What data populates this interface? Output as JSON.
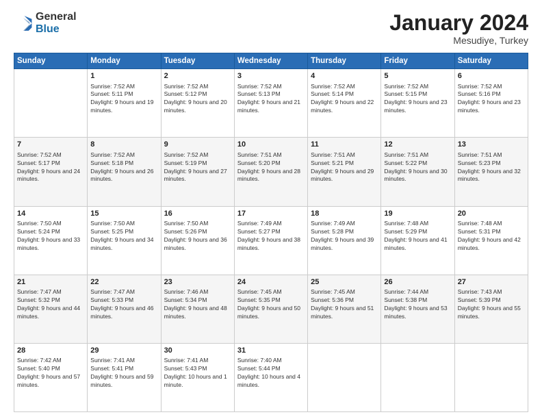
{
  "logo": {
    "general": "General",
    "blue": "Blue"
  },
  "title": "January 2024",
  "subtitle": "Mesudiye, Turkey",
  "header_days": [
    "Sunday",
    "Monday",
    "Tuesday",
    "Wednesday",
    "Thursday",
    "Friday",
    "Saturday"
  ],
  "weeks": [
    [
      {
        "day": "",
        "sunrise": "",
        "sunset": "",
        "daylight": ""
      },
      {
        "day": "1",
        "sunrise": "Sunrise: 7:52 AM",
        "sunset": "Sunset: 5:11 PM",
        "daylight": "Daylight: 9 hours and 19 minutes."
      },
      {
        "day": "2",
        "sunrise": "Sunrise: 7:52 AM",
        "sunset": "Sunset: 5:12 PM",
        "daylight": "Daylight: 9 hours and 20 minutes."
      },
      {
        "day": "3",
        "sunrise": "Sunrise: 7:52 AM",
        "sunset": "Sunset: 5:13 PM",
        "daylight": "Daylight: 9 hours and 21 minutes."
      },
      {
        "day": "4",
        "sunrise": "Sunrise: 7:52 AM",
        "sunset": "Sunset: 5:14 PM",
        "daylight": "Daylight: 9 hours and 22 minutes."
      },
      {
        "day": "5",
        "sunrise": "Sunrise: 7:52 AM",
        "sunset": "Sunset: 5:15 PM",
        "daylight": "Daylight: 9 hours and 23 minutes."
      },
      {
        "day": "6",
        "sunrise": "Sunrise: 7:52 AM",
        "sunset": "Sunset: 5:16 PM",
        "daylight": "Daylight: 9 hours and 23 minutes."
      }
    ],
    [
      {
        "day": "7",
        "sunrise": "Sunrise: 7:52 AM",
        "sunset": "Sunset: 5:17 PM",
        "daylight": "Daylight: 9 hours and 24 minutes."
      },
      {
        "day": "8",
        "sunrise": "Sunrise: 7:52 AM",
        "sunset": "Sunset: 5:18 PM",
        "daylight": "Daylight: 9 hours and 26 minutes."
      },
      {
        "day": "9",
        "sunrise": "Sunrise: 7:52 AM",
        "sunset": "Sunset: 5:19 PM",
        "daylight": "Daylight: 9 hours and 27 minutes."
      },
      {
        "day": "10",
        "sunrise": "Sunrise: 7:51 AM",
        "sunset": "Sunset: 5:20 PM",
        "daylight": "Daylight: 9 hours and 28 minutes."
      },
      {
        "day": "11",
        "sunrise": "Sunrise: 7:51 AM",
        "sunset": "Sunset: 5:21 PM",
        "daylight": "Daylight: 9 hours and 29 minutes."
      },
      {
        "day": "12",
        "sunrise": "Sunrise: 7:51 AM",
        "sunset": "Sunset: 5:22 PM",
        "daylight": "Daylight: 9 hours and 30 minutes."
      },
      {
        "day": "13",
        "sunrise": "Sunrise: 7:51 AM",
        "sunset": "Sunset: 5:23 PM",
        "daylight": "Daylight: 9 hours and 32 minutes."
      }
    ],
    [
      {
        "day": "14",
        "sunrise": "Sunrise: 7:50 AM",
        "sunset": "Sunset: 5:24 PM",
        "daylight": "Daylight: 9 hours and 33 minutes."
      },
      {
        "day": "15",
        "sunrise": "Sunrise: 7:50 AM",
        "sunset": "Sunset: 5:25 PM",
        "daylight": "Daylight: 9 hours and 34 minutes."
      },
      {
        "day": "16",
        "sunrise": "Sunrise: 7:50 AM",
        "sunset": "Sunset: 5:26 PM",
        "daylight": "Daylight: 9 hours and 36 minutes."
      },
      {
        "day": "17",
        "sunrise": "Sunrise: 7:49 AM",
        "sunset": "Sunset: 5:27 PM",
        "daylight": "Daylight: 9 hours and 38 minutes."
      },
      {
        "day": "18",
        "sunrise": "Sunrise: 7:49 AM",
        "sunset": "Sunset: 5:28 PM",
        "daylight": "Daylight: 9 hours and 39 minutes."
      },
      {
        "day": "19",
        "sunrise": "Sunrise: 7:48 AM",
        "sunset": "Sunset: 5:29 PM",
        "daylight": "Daylight: 9 hours and 41 minutes."
      },
      {
        "day": "20",
        "sunrise": "Sunrise: 7:48 AM",
        "sunset": "Sunset: 5:31 PM",
        "daylight": "Daylight: 9 hours and 42 minutes."
      }
    ],
    [
      {
        "day": "21",
        "sunrise": "Sunrise: 7:47 AM",
        "sunset": "Sunset: 5:32 PM",
        "daylight": "Daylight: 9 hours and 44 minutes."
      },
      {
        "day": "22",
        "sunrise": "Sunrise: 7:47 AM",
        "sunset": "Sunset: 5:33 PM",
        "daylight": "Daylight: 9 hours and 46 minutes."
      },
      {
        "day": "23",
        "sunrise": "Sunrise: 7:46 AM",
        "sunset": "Sunset: 5:34 PM",
        "daylight": "Daylight: 9 hours and 48 minutes."
      },
      {
        "day": "24",
        "sunrise": "Sunrise: 7:45 AM",
        "sunset": "Sunset: 5:35 PM",
        "daylight": "Daylight: 9 hours and 50 minutes."
      },
      {
        "day": "25",
        "sunrise": "Sunrise: 7:45 AM",
        "sunset": "Sunset: 5:36 PM",
        "daylight": "Daylight: 9 hours and 51 minutes."
      },
      {
        "day": "26",
        "sunrise": "Sunrise: 7:44 AM",
        "sunset": "Sunset: 5:38 PM",
        "daylight": "Daylight: 9 hours and 53 minutes."
      },
      {
        "day": "27",
        "sunrise": "Sunrise: 7:43 AM",
        "sunset": "Sunset: 5:39 PM",
        "daylight": "Daylight: 9 hours and 55 minutes."
      }
    ],
    [
      {
        "day": "28",
        "sunrise": "Sunrise: 7:42 AM",
        "sunset": "Sunset: 5:40 PM",
        "daylight": "Daylight: 9 hours and 57 minutes."
      },
      {
        "day": "29",
        "sunrise": "Sunrise: 7:41 AM",
        "sunset": "Sunset: 5:41 PM",
        "daylight": "Daylight: 9 hours and 59 minutes."
      },
      {
        "day": "30",
        "sunrise": "Sunrise: 7:41 AM",
        "sunset": "Sunset: 5:43 PM",
        "daylight": "Daylight: 10 hours and 1 minute."
      },
      {
        "day": "31",
        "sunrise": "Sunrise: 7:40 AM",
        "sunset": "Sunset: 5:44 PM",
        "daylight": "Daylight: 10 hours and 4 minutes."
      },
      {
        "day": "",
        "sunrise": "",
        "sunset": "",
        "daylight": ""
      },
      {
        "day": "",
        "sunrise": "",
        "sunset": "",
        "daylight": ""
      },
      {
        "day": "",
        "sunrise": "",
        "sunset": "",
        "daylight": ""
      }
    ]
  ]
}
